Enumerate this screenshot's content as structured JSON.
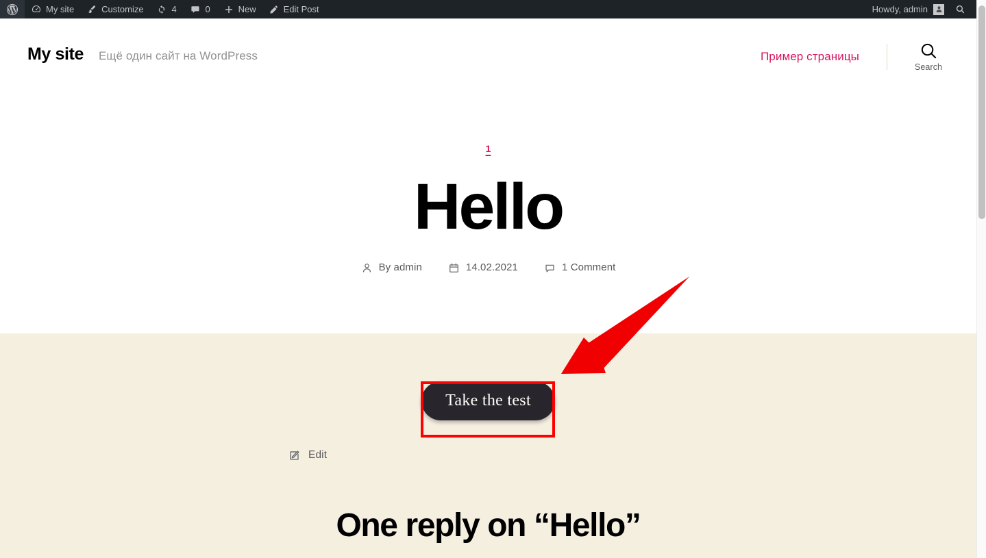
{
  "adminbar": {
    "wp_logo_name": "wordpress-logo-icon",
    "items": [
      {
        "label": "My site",
        "icon": "dashboard-icon",
        "name": "adminbar-my-site"
      },
      {
        "label": "Customize",
        "icon": "paintbrush-icon",
        "name": "adminbar-customize"
      },
      {
        "label": "4",
        "icon": "updates-icon",
        "name": "adminbar-updates"
      },
      {
        "label": "0",
        "icon": "comment-bubble-icon",
        "name": "adminbar-comments"
      },
      {
        "label": "New",
        "icon": "plus-icon",
        "name": "adminbar-new"
      },
      {
        "label": "Edit Post",
        "icon": "pencil-icon",
        "name": "adminbar-edit-post"
      }
    ],
    "howdy": "Howdy, admin",
    "avatar_icon": "user-avatar-icon",
    "search_icon": "search-icon"
  },
  "header": {
    "site_title": "My site",
    "tagline": "Ещё один сайт на WordPress",
    "menu": [
      {
        "label": "Пример страницы",
        "name": "menu-item-sample-page"
      }
    ],
    "search_label": "Search",
    "search_icon": "search-icon"
  },
  "post": {
    "category": "1",
    "title": "Hello",
    "meta": [
      {
        "icon": "person-icon",
        "text": "By admin",
        "name": "post-author"
      },
      {
        "icon": "calendar-icon",
        "text": "14.02.2021",
        "name": "post-date"
      },
      {
        "icon": "comment-icon",
        "text": "1 Comment",
        "name": "post-comment-count"
      }
    ],
    "cta_label": "Take the test",
    "edit_label": "Edit",
    "edit_icon": "edit-pencil-icon",
    "comments_heading": "One reply on “Hello”"
  },
  "colors": {
    "admin_bar_bg": "#1d2327",
    "accent_pink": "#d8155e",
    "beige_bg": "#f5efe0",
    "button_bg": "#28262c",
    "annotation_red": "#ff0000"
  },
  "annotations": {
    "arrow": "red-arrow-pointing-to-cta",
    "highlight": "red-highlight-box-around-cta"
  }
}
